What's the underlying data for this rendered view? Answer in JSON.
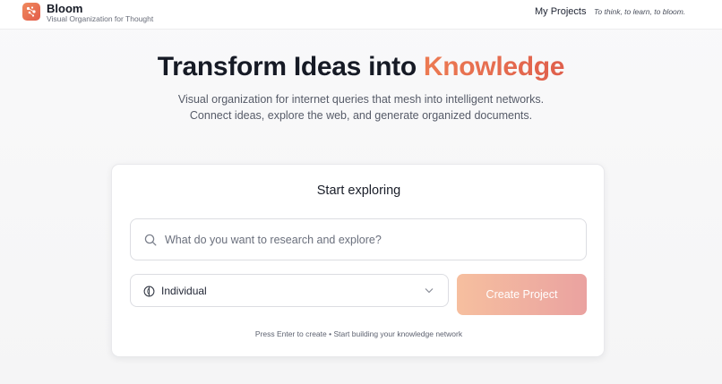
{
  "header": {
    "brand_name": "Bloom",
    "brand_tagline": "Visual Organization for Thought",
    "nav_projects": "My Projects",
    "nav_tagline": "To think, to learn, to bloom."
  },
  "hero": {
    "title_prefix": "Transform Ideas into ",
    "title_accent": "Knowledge",
    "subtitle": "Visual organization for internet queries that mesh into intelligent networks. Connect ideas, explore the web, and generate organized documents."
  },
  "card": {
    "title": "Start exploring",
    "search_placeholder": "What do you want to research and explore?",
    "search_value": "",
    "mode_selected": "Individual",
    "create_label": "Create Project",
    "hint": "Press Enter to create • Start building your knowledge network"
  },
  "colors": {
    "accent_start": "#ec7a52",
    "accent_end": "#df5f4c",
    "button_start": "#f6bf9f",
    "button_end": "#eaa2a0"
  },
  "icons": {
    "logo": "bloom-sparkle-icon",
    "search": "search-icon",
    "mode": "individual-mode-icon",
    "dropdown": "chevron-down-icon"
  }
}
